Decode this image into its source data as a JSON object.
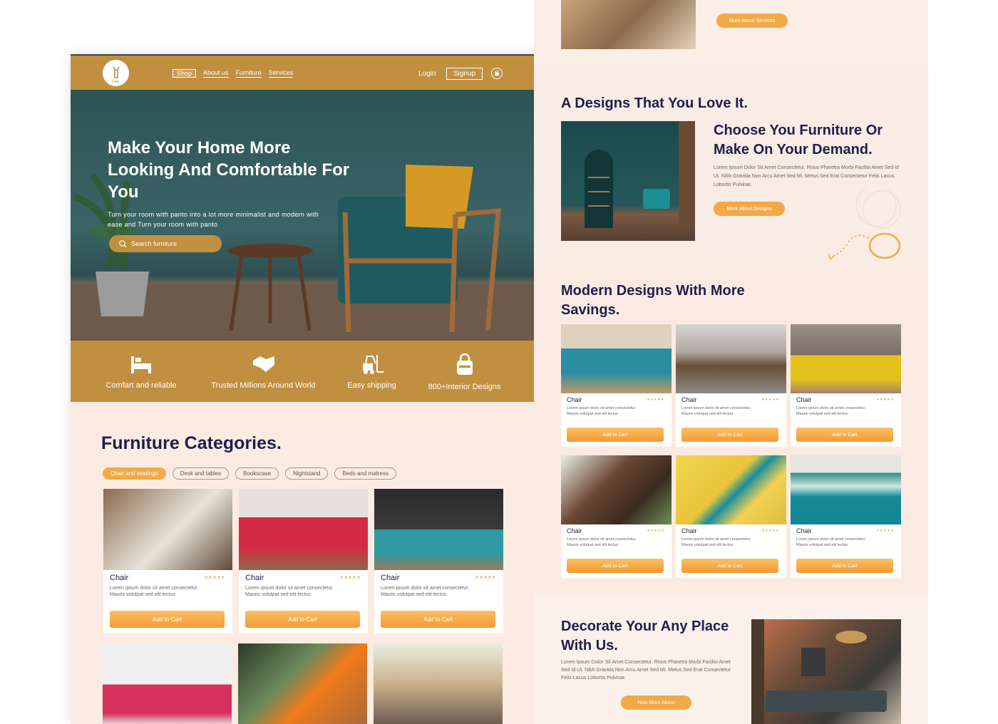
{
  "nav": {
    "logo_text": "Deer",
    "links": [
      "Shop",
      "About us",
      "Furniture",
      "Services"
    ],
    "login": "Login",
    "signup": "Signup"
  },
  "hero": {
    "title": "Make Your Home More Looking And Comfortable For You",
    "subtitle": "Turn your room with panto into a lot more minimalist and modern with ease and Turn your room with panto",
    "search_placeholder": "Search furniture"
  },
  "features": [
    {
      "icon": "bed-icon",
      "label": "Comfart and reliable"
    },
    {
      "icon": "handshake-icon",
      "label": "Trusted Millions Around World"
    },
    {
      "icon": "forklift-icon",
      "label": "Easy shipping"
    },
    {
      "icon": "bag-icon",
      "label": "800+Interior Designs"
    }
  ],
  "categories": {
    "title": "Furniture Categories.",
    "pills": [
      "Chair and seatings",
      "Desk and tables",
      "Bookscase",
      "Nightstand",
      "Beds and matress"
    ],
    "active_pill": "Chair and seatings"
  },
  "products": [
    {
      "name": "Chair",
      "stars": "★★★★★",
      "desc": "Lorem ipsum dolor sit amet consectetur. Mauris volutpat sed elit lectus",
      "button": "Add to Cart"
    },
    {
      "name": "Chair",
      "stars": "★★★★★",
      "desc": "Lorem ipsum dolor sit amet consectetur. Mauris volutpat sed elit lectus",
      "button": "Add to Cart"
    },
    {
      "name": "Chair",
      "stars": "★★★★★",
      "desc": "Lorem ipsum dolor sit amet consectetur. Mauris volutpat sed elit lectus",
      "button": "Add to Cart"
    }
  ],
  "services": {
    "button": "More About Services"
  },
  "designs": {
    "heading": "A Designs That You Love It.",
    "subheading": "Choose You Furniture Or Make On Your Demand.",
    "text": "Lorem Ipsum Dolor Sit Amet Consectetur. Risus Pharetra Morbi Facilisi Amet Sed Id Ut. Nibh Gravida Non Arcu Amet Sed Mi. Metus Sed Erat Consectetur Felis Lacus Lobortis Pulvinar.",
    "button": "More About Designs"
  },
  "modern": {
    "title": "Modern Designs With More Savings.",
    "cards": [
      {
        "name": "Chair",
        "stars": "★★★★★",
        "desc": "Lorem ipsum dolor sit amet consectetur. Mauris volutpat sed elit lectus",
        "button": "Add to Cart"
      },
      {
        "name": "Chair",
        "stars": "★★★★★",
        "desc": "Lorem ipsum dolor sit amet consectetur. Mauris volutpat sed elit lectus",
        "button": "Add to Cart"
      },
      {
        "name": "Chair",
        "stars": "★★★★★",
        "desc": "Lorem ipsum dolor sit amet consectetur. Mauris volutpat sed elit lectus",
        "button": "Add to Cart"
      },
      {
        "name": "Chair",
        "stars": "★★★★★",
        "desc": "Lorem ipsum dolor sit amet consectetur. Mauris volutpat sed elit lectus",
        "button": "Add to Cart"
      },
      {
        "name": "Chair",
        "stars": "★★★★★",
        "desc": "Lorem ipsum dolor sit amet consectetur. Mauris volutpat sed elit lectus",
        "button": "Add to Cart"
      },
      {
        "name": "Chair",
        "stars": "★★★★★",
        "desc": "Lorem ipsum dolor sit amet consectetur. Mauris volutpat sed elit lectus",
        "button": "Add to Cart"
      }
    ]
  },
  "decorate": {
    "title": "Decorate Your Any Place With Us.",
    "text": "Lorem Ipsum Dolor Sit Amet Consectetur. Risus Pharetra Morbi Facilisi Amet Sed Id Ut. Nibh Gravida Non Arcu Amet Sed Mi. Metus Sed Erat Consectetur Felis Lacus Lobortis Pulvinar.",
    "button": "Now More About"
  },
  "colors": {
    "brand": "#c18f40",
    "accent": "#f2a94a",
    "heading": "#1f1f4d",
    "background": "#fcebe2"
  }
}
